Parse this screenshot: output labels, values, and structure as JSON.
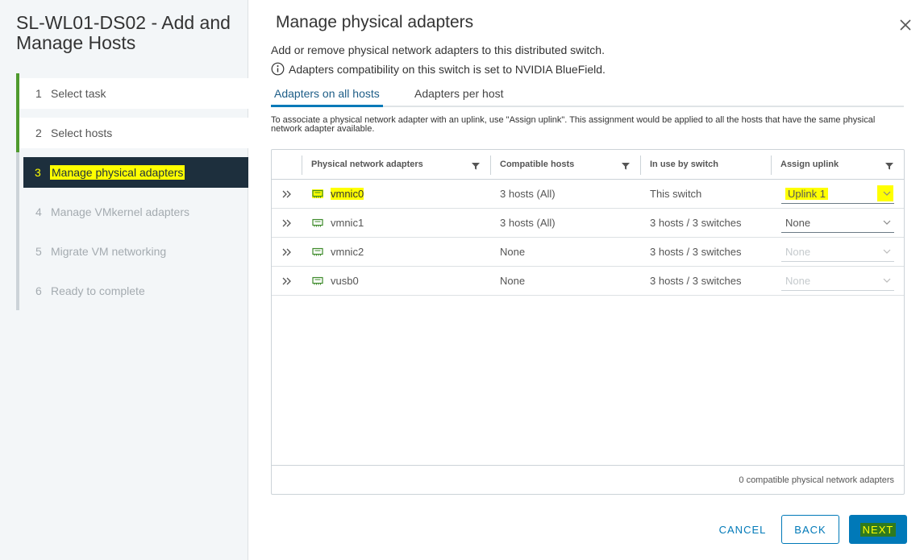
{
  "wizard": {
    "title": "SL-WL01-DS02 - Add and Manage Hosts",
    "steps": [
      {
        "num": "1",
        "label": "Select task"
      },
      {
        "num": "2",
        "label": "Select hosts"
      },
      {
        "num": "3",
        "label": "Manage physical adapters"
      },
      {
        "num": "4",
        "label": "Manage VMkernel adapters"
      },
      {
        "num": "5",
        "label": "Migrate VM networking"
      },
      {
        "num": "6",
        "label": "Ready to complete"
      }
    ]
  },
  "page": {
    "title": "Manage physical adapters",
    "description": "Add or remove physical network adapters to this distributed switch.",
    "compat_note": "Adapters compatibility on this switch is set to NVIDIA BlueField.",
    "association_note": "To associate a physical network adapter with an uplink, use \"Assign uplink\". This assignment would be applied to all the hosts that have the same physical network adapter available."
  },
  "tabs": [
    {
      "label": "Adapters on all hosts",
      "active": true
    },
    {
      "label": "Adapters per host",
      "active": false
    }
  ],
  "grid": {
    "columns": [
      "Physical network adapters",
      "Compatible hosts",
      "In use by switch",
      "Assign uplink"
    ],
    "rows": [
      {
        "adapter": "vmnic0",
        "compatible": "3 hosts (All)",
        "in_use": "This switch",
        "uplink": "Uplink 1"
      },
      {
        "adapter": "vmnic1",
        "compatible": "3 hosts (All)",
        "in_use": "3 hosts / 3 switches",
        "uplink": "None"
      },
      {
        "adapter": "vmnic2",
        "compatible": "None",
        "in_use": "3 hosts / 3 switches",
        "uplink": "None"
      },
      {
        "adapter": "vusb0",
        "compatible": "None",
        "in_use": "3 hosts / 3 switches",
        "uplink": "None"
      }
    ],
    "footer": "0 compatible physical network adapters"
  },
  "buttons": {
    "cancel": "CANCEL",
    "back": "BACK",
    "next": "NEXT"
  },
  "colors": {
    "accent": "#0079b8",
    "active_step_bg": "#1d2f3d",
    "done_step_bar": "#4f9a2e",
    "highlight": "#ffff00"
  },
  "icons": [
    "close-icon",
    "info-icon",
    "filter-icon",
    "expand-icon",
    "network-adapter-icon",
    "chevron-down-icon"
  ]
}
